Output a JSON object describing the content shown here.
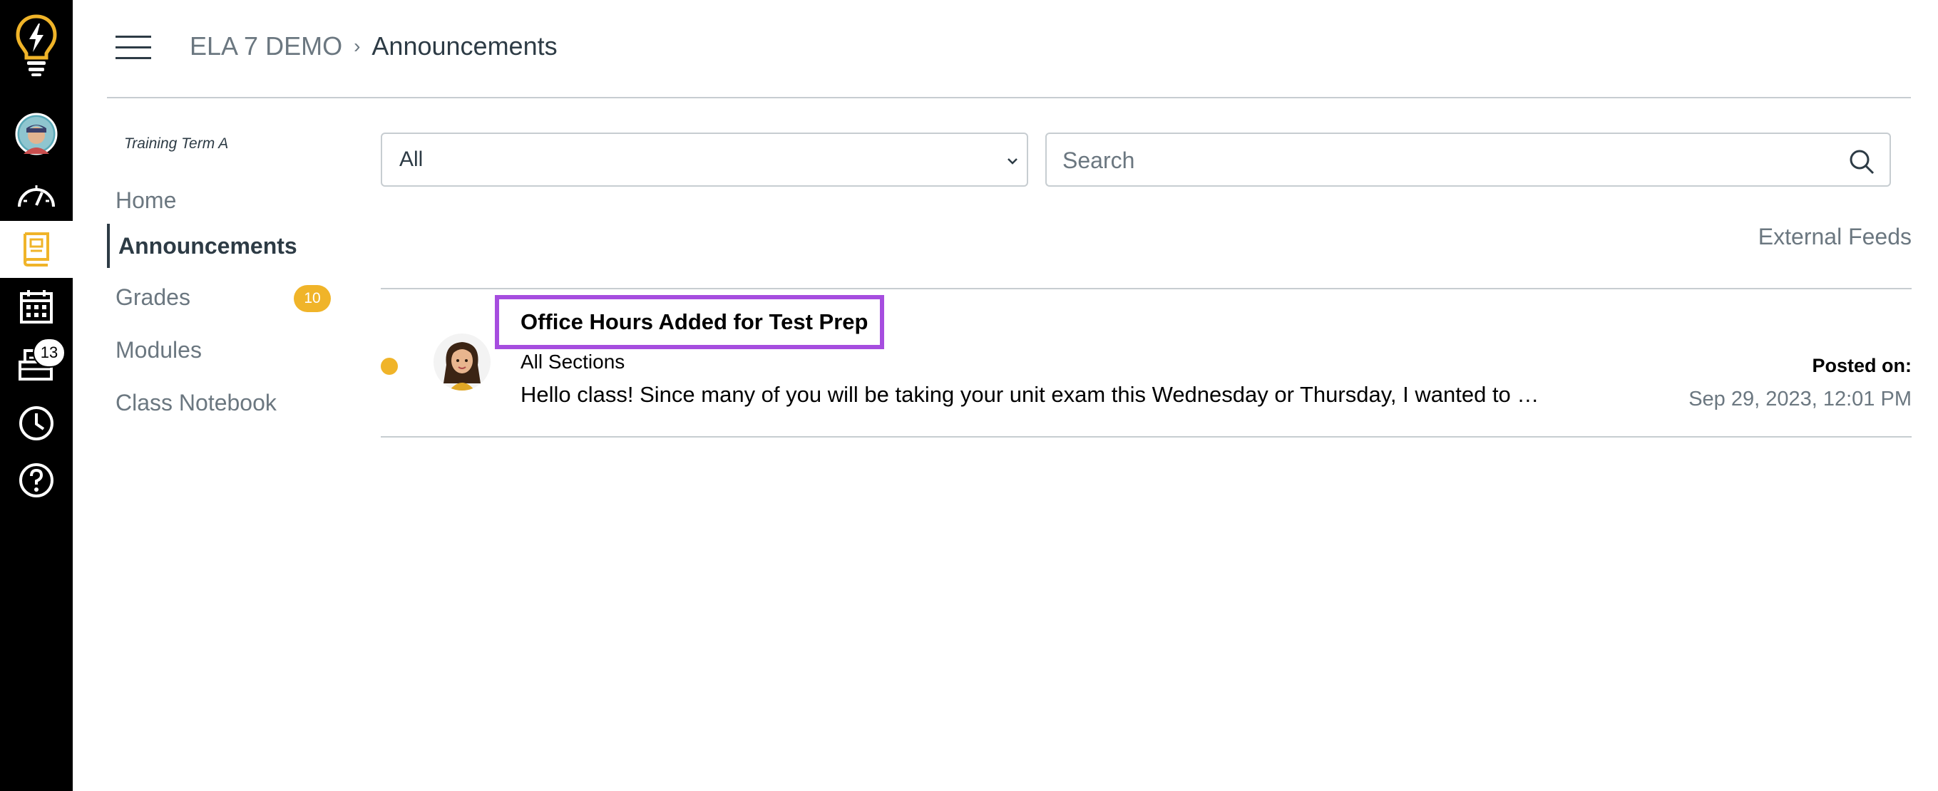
{
  "global_nav": {
    "items": [
      {
        "icon": "lightbulb-logo-icon"
      },
      {
        "icon": "user-avatar"
      },
      {
        "icon": "dashboard-icon"
      },
      {
        "icon": "courses-icon",
        "active": true
      },
      {
        "icon": "calendar-icon"
      },
      {
        "icon": "inbox-icon",
        "badge": "13"
      },
      {
        "icon": "history-icon"
      },
      {
        "icon": "help-icon"
      }
    ],
    "inbox_badge": "13",
    "brand_color": "#f0b429"
  },
  "breadcrumb": {
    "course": "ELA 7 DEMO",
    "separator": "›",
    "current": "Announcements"
  },
  "course_nav": {
    "term": "Training Term A",
    "items": [
      {
        "label": "Home"
      },
      {
        "label": "Announcements",
        "active": true
      },
      {
        "label": "Grades",
        "badge": "10"
      },
      {
        "label": "Modules"
      },
      {
        "label": "Class Notebook"
      }
    ]
  },
  "filters": {
    "selected": "All",
    "search_placeholder": "Search",
    "search_value": ""
  },
  "external_feeds": "External Feeds",
  "announcements": [
    {
      "title": "Office Hours Added for Test Prep",
      "sections": "All Sections",
      "preview": "Hello class! Since many of you will be taking your unit exam this Wednesday or Thursday, I wanted to …",
      "posted_label": "Posted on:",
      "posted_date": "Sep 29, 2023, 12:01 PM",
      "unread": true
    }
  ],
  "colors": {
    "highlight": "#a64ddf",
    "badge": "#f0b429",
    "text": "#2d3b45",
    "muted": "#6b7780"
  }
}
